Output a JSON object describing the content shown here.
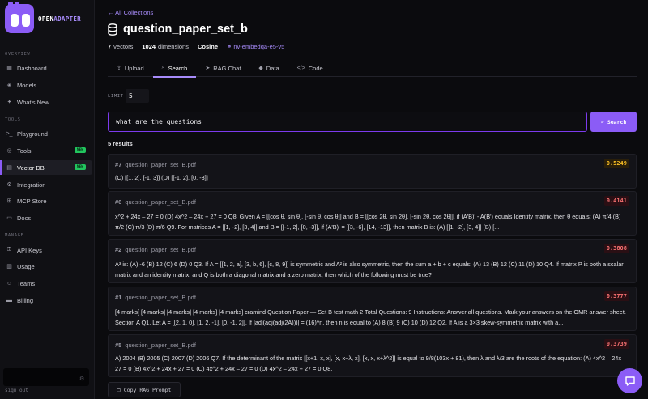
{
  "brand": {
    "name_a": "OPEN",
    "name_b": "ADAPTER",
    "accent": "#8b5cf6"
  },
  "sidebar": {
    "sections": {
      "overview": "OVERVIEW",
      "tools": "TOOLS",
      "manage": "MANAGE"
    },
    "items": [
      {
        "label": "Dashboard",
        "icon": "grid-icon"
      },
      {
        "label": "Models",
        "icon": "cube-icon"
      },
      {
        "label": "What's New",
        "icon": "sparkle-icon"
      },
      {
        "label": "Playground",
        "icon": "terminal-icon"
      },
      {
        "label": "Tools",
        "icon": "globe-icon",
        "badge": "NEW"
      },
      {
        "label": "Vector DB",
        "icon": "database-icon",
        "badge": "NEW",
        "active": true
      },
      {
        "label": "Integration",
        "icon": "plug-icon"
      },
      {
        "label": "MCP Store",
        "icon": "store-icon"
      },
      {
        "label": "Docs",
        "icon": "book-icon"
      },
      {
        "label": "API Keys",
        "icon": "key-icon"
      },
      {
        "label": "Usage",
        "icon": "chart-icon"
      },
      {
        "label": "Teams",
        "icon": "users-icon"
      },
      {
        "label": "Billing",
        "icon": "card-icon"
      }
    ],
    "sign_out": "sign out"
  },
  "header": {
    "back_link": "← All Collections",
    "title": "question_paper_set_b",
    "vectors_count": "7",
    "vectors_label": "vectors",
    "dimensions_count": "1024",
    "dimensions_label": "dimensions",
    "metric": "Cosine",
    "model": "nv-embedqa-e5-v5"
  },
  "tabs": [
    {
      "label": "Upload",
      "icon": "upload-icon"
    },
    {
      "label": "Search",
      "icon": "search-icon",
      "active": true
    },
    {
      "label": "RAG Chat",
      "icon": "send-icon"
    },
    {
      "label": "Data",
      "icon": "layers-icon"
    },
    {
      "label": "Code",
      "icon": "code-icon"
    }
  ],
  "search": {
    "limit_label": "LIMIT",
    "limit_value": "5",
    "query": "what are the questions",
    "button_label": "Search"
  },
  "results": {
    "count_label": "5 results",
    "items": [
      {
        "rank": "#7",
        "file": "question_paper_set_B.pdf",
        "score": "0.5249",
        "text": "(C) [[1, 2], [-1, 3]] (D) [[-1, 2], [0, -3]]"
      },
      {
        "rank": "#6",
        "file": "question_paper_set_B.pdf",
        "score": "0.4141",
        "text": "x^2 + 24x – 27 = 0 (D) 4x^2 – 24x + 27 = 0 Q8. Given A = [[cos θ, sin θ], [-sin θ, cos θ]] and B = [[cos 2θ, sin 2θ], [-sin 2θ, cos 2θ]], if (A'B)' - A(B') equals Identity matrix, then θ equals: (A) π/4 (B) π/2 (C) π/3 (D) π/6 Q9. For matrices A = [[1, -2], [3, 4]] and B = [[-1, 2], [0, -3]], if (A'B)' = [[3, -6], [14, -13]], then matrix B is: (A) [[1, -2], [3, 4]] (B) [..."
      },
      {
        "rank": "#2",
        "file": "question_paper_set_B.pdf",
        "score": "0.3808",
        "text": "A³ is: (A) -6 (B) 12 (C) 6 (D) 0 Q3. If A = [[1, 2, a], [3, b, 6], [c, 8, 9]] is symmetric and A² is also symmetric, then the sum a + b + c equals: (A) 13 (B) 12 (C) 11 (D) 10 Q4. If matrix P is both a scalar matrix and an identity matrix, and Q is both a diagonal matrix and a zero matrix, then which of the following must be true?"
      },
      {
        "rank": "#1",
        "file": "question_paper_set_B.pdf",
        "score": "0.3777",
        "text": "[4 marks] [4 marks] [4 marks] [4 marks] [4 marks] cramind Question Paper — Set B test math 2 Total Questions: 9 Instructions: Answer all questions. Mark your answers on the OMR answer sheet. Section A Q1. Let A = [[2, 1, 0], [1, 2, -1], [0, -1, 2]]. If |adj(adj(adj(2A)))| = (16)^n, then n is equal to (A) 8 (B) 9 (C) 10 (D) 12 Q2. If A is a 3×3 skew-symmetric matrix with a..."
      },
      {
        "rank": "#5",
        "file": "question_paper_set_B.pdf",
        "score": "0.3739",
        "text": "A) 2004 (B) 2005 (C) 2007 (D) 2006 Q7. If the determinant of the matrix [[x+1, x, x], [x, x+λ, x], [x, x, x+λ^2]] is equal to 9/8(103x + 81), then λ and λ/3 are the roots of the equation: (A) 4x^2 – 24x – 27 = 0 (B) 4x^2 + 24x + 27 = 0 (C) 4x^2 + 24x – 27 = 0 (D) 4x^2 – 24x + 27 = 0 Q8."
      }
    ]
  },
  "footer": {
    "copy_label": "Copy RAG Prompt"
  }
}
